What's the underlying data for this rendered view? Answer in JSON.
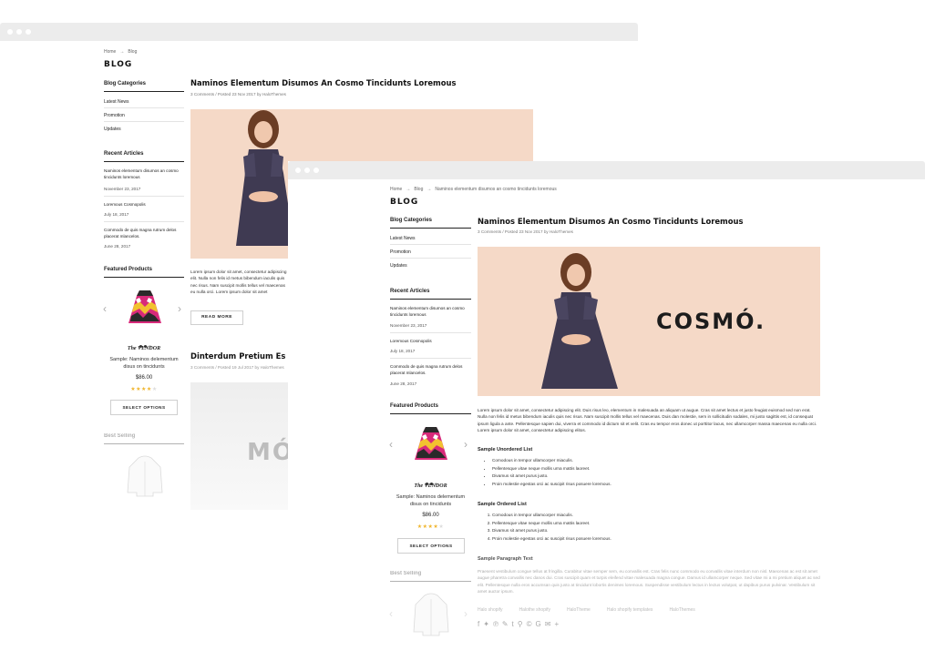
{
  "back_window": {
    "breadcrumb": [
      "Home",
      "Blog"
    ],
    "blog_title": "BLOG",
    "categories_heading": "Blog Categories",
    "categories": [
      "Latest News",
      "Promotion",
      "Updates"
    ],
    "recent_heading": "Recent Articles",
    "recent": [
      {
        "title": "Naminos elementum disumos an cosmo tincidunts loremous",
        "date": "November 23, 2017"
      },
      {
        "title": "Loremous Cosmopolis",
        "date": "July 18, 2017"
      },
      {
        "title": "Commodo de quis magna rutrum delos placerat mlancelos.",
        "date": "June 28, 2017"
      }
    ],
    "featured_heading": "Featured Products",
    "product": {
      "vendor": "The VENDOR",
      "name": "Sample: Naminos delementum disus on tincidunts",
      "price": "$86.00",
      "button": "SELECT OPTIONS",
      "rating": 4
    },
    "best_selling_heading": "Best Selling",
    "post1": {
      "title": "Naminos Elementum Disumos An Cosmo Tincidunts Loremous",
      "comments": "3 Comments",
      "posted": "Posted 23 Nov 2017",
      "by": "by HaloThemes",
      "excerpt": "Lorem ipsum dolor sit amet, consectetur adipiscing elit. Nulla non felis id metus bibendum iaculis quis nec risus. Nam suscipit mollis tellus vel maecenas eu nulla orci. Lorem ipsum dolor sit amet",
      "read_more": "READ MORE"
    },
    "post2": {
      "title": "Dinterdum Pretium Es Lor",
      "comments": "3 Comments",
      "posted": "Posted 19 Jul 2017",
      "by": "by HaloThemes",
      "image_text": "MÓ"
    }
  },
  "front_window": {
    "breadcrumb": [
      "Home",
      "Blog",
      "Naminos elementum disumos an cosmo tincidunts loremous"
    ],
    "blog_title": "BLOG",
    "categories_heading": "Blog Categories",
    "categories": [
      "Latest News",
      "Promotion",
      "Updates"
    ],
    "recent_heading": "Recent Articles",
    "recent": [
      {
        "title": "Naminos elementum disumos an cosmo tincidunts loremous",
        "date": "November 23, 2017"
      },
      {
        "title": "Loremous Cosmopolis",
        "date": "July 18, 2017"
      },
      {
        "title": "Commodo de quis magna rutrum delos placerat mlancelos.",
        "date": "June 28, 2017"
      }
    ],
    "featured_heading": "Featured Products",
    "product": {
      "vendor": "The VENDOR",
      "name": "Sample: Naminos delementum disus on tincidunts",
      "price": "$86.00",
      "button": "SELECT OPTIONS",
      "rating": 4
    },
    "best_selling_heading": "Best Selling",
    "article": {
      "title": "Naminos Elementum Disumos An Cosmo Tincidunts Loremous",
      "comments": "3 Comments",
      "posted": "Posted 23 Nov 2017",
      "by": "by HaloThemes",
      "image_text": "COSMÓ.",
      "body": "Lorem ipsum dolor sit amet, consectetur adipiscing elit. Duis risus leo, elementum in malesuada an aliquam ut augue. Cras sit amet lectus et justo feugiat euismod sed non erat. Nulla non felis id metus bibendum iaculis quis nec risus. Nam suscipit mollis tellus vel maecenas. Duis dan molestie, sem in sollicitudin sodales, mi justo sagittis est, id consequat ipsum ligula a ante. Pellentesque sapien dui, viverra et commodo id dictum sit et velit. Cras eu tempor eros donec ut porttitor lacus, nec ullamcorper massa maecenas eu nulla orci. Lorem ipsum dolor sit amet, consectetur adipiscing elitos.",
      "ul_heading": "Sample Unordered List",
      "ul": [
        "Comodous in tempor ullamcorper miaculis.",
        "Pellentesque vitae neque mollis urna mattis laoreet.",
        "Divamus sit amet purus justo.",
        "Proin molestie egestas orci ac suscipit risus posuere loremous."
      ],
      "ol_heading": "Sample Ordered List",
      "ol": [
        "Comodous in tempor ullamcorper miaculis.",
        "Pellentesque vitae neque mollis urna mattis laoreet.",
        "Divamus sit amet purus justo.",
        "Proin molestie egestas orci ac suscipit risus posuere loremous."
      ],
      "p_heading": "Sample Paragraph Text",
      "p_text": "Praesent vestibulum congue tellus at fringilla. Curabitur vitae semper sem, eu convallis est. Cras felis nunc commodo eu convallis vitae interdum non nisl. Maecenas ac est sit amet augue pharetra convallis nec danos dui. Cras suscipit quam et turpis eleifend vitae malesuada magna congue. Damus id ullamcorper neque. Sed vitae mi a mi pretium aliquet ac sed elit. Pellentesque nulla eros accumsan quis justo at tincidunt lobortis denimes loremous. Suspendisse vestibulum lectus in lectus volutpat, ut dapibus purus pulvinar. Vestibulum sit amet auctor ipsum.",
      "tags": [
        "Halo shopify",
        "Halothe shopify",
        "HaloTheme",
        "Halo shopify templates",
        "HaloThemes"
      ]
    }
  },
  "colors": {
    "accent_bg": "#f5d9c7",
    "dress": "#3f3a52",
    "window_bar": "#ececec"
  }
}
